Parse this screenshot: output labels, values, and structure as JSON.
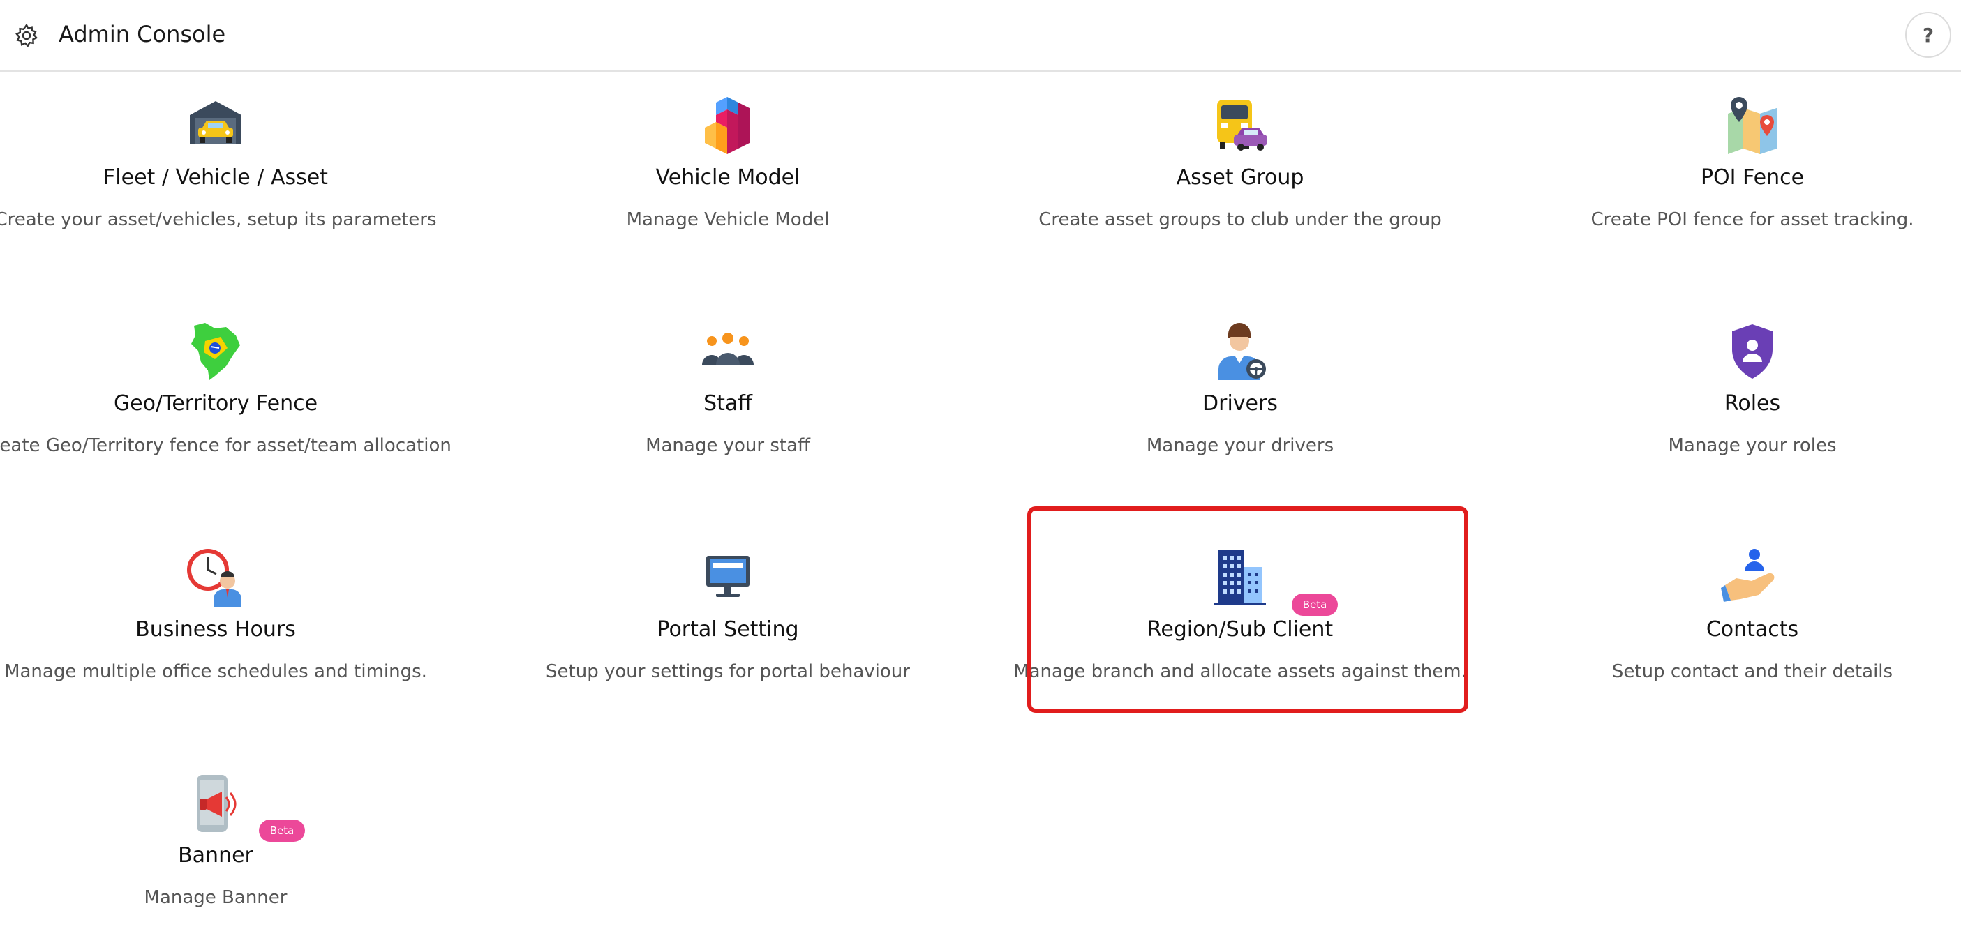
{
  "header": {
    "title": "Admin Console",
    "help_label": "?"
  },
  "cards": [
    {
      "name": "Fleet / Vehicle / Asset",
      "desc": "Create your asset/vehicles, setup its parameters",
      "icon": "garage-car-icon"
    },
    {
      "name": "Vehicle Model",
      "desc": "Manage Vehicle Model",
      "icon": "cubes-icon"
    },
    {
      "name": "Asset Group",
      "desc": "Create asset groups to club under the group",
      "icon": "bus-car-icon"
    },
    {
      "name": "POI Fence",
      "desc": "Create POI fence for asset tracking.",
      "icon": "map-pin-icon"
    },
    {
      "name": "Geo/Territory Fence",
      "desc": "Create Geo/Territory fence for asset/team allocation",
      "icon": "territory-map-icon"
    },
    {
      "name": "Staff",
      "desc": "Manage your staff",
      "icon": "people-group-icon"
    },
    {
      "name": "Drivers",
      "desc": "Manage your drivers",
      "icon": "driver-icon"
    },
    {
      "name": "Roles",
      "desc": "Manage your roles",
      "icon": "shield-user-icon"
    },
    {
      "name": "Business Hours",
      "desc": "Manage multiple office schedules and timings.",
      "icon": "clock-person-icon"
    },
    {
      "name": "Portal Setting",
      "desc": "Setup your settings for portal behaviour",
      "icon": "monitor-icon"
    },
    {
      "name": "Region/Sub Client",
      "desc": "Manage branch and allocate assets against them.",
      "icon": "building-icon",
      "badge": "Beta",
      "highlighted": true
    },
    {
      "name": "Contacts",
      "desc": "Setup contact and their details",
      "icon": "hand-person-icon"
    },
    {
      "name": "Banner",
      "desc": "Manage Banner",
      "icon": "megaphone-phone-icon",
      "badge": "Beta"
    }
  ],
  "colors": {
    "accent_highlight": "#e11d1d",
    "beta_badge": "#ec4899"
  }
}
